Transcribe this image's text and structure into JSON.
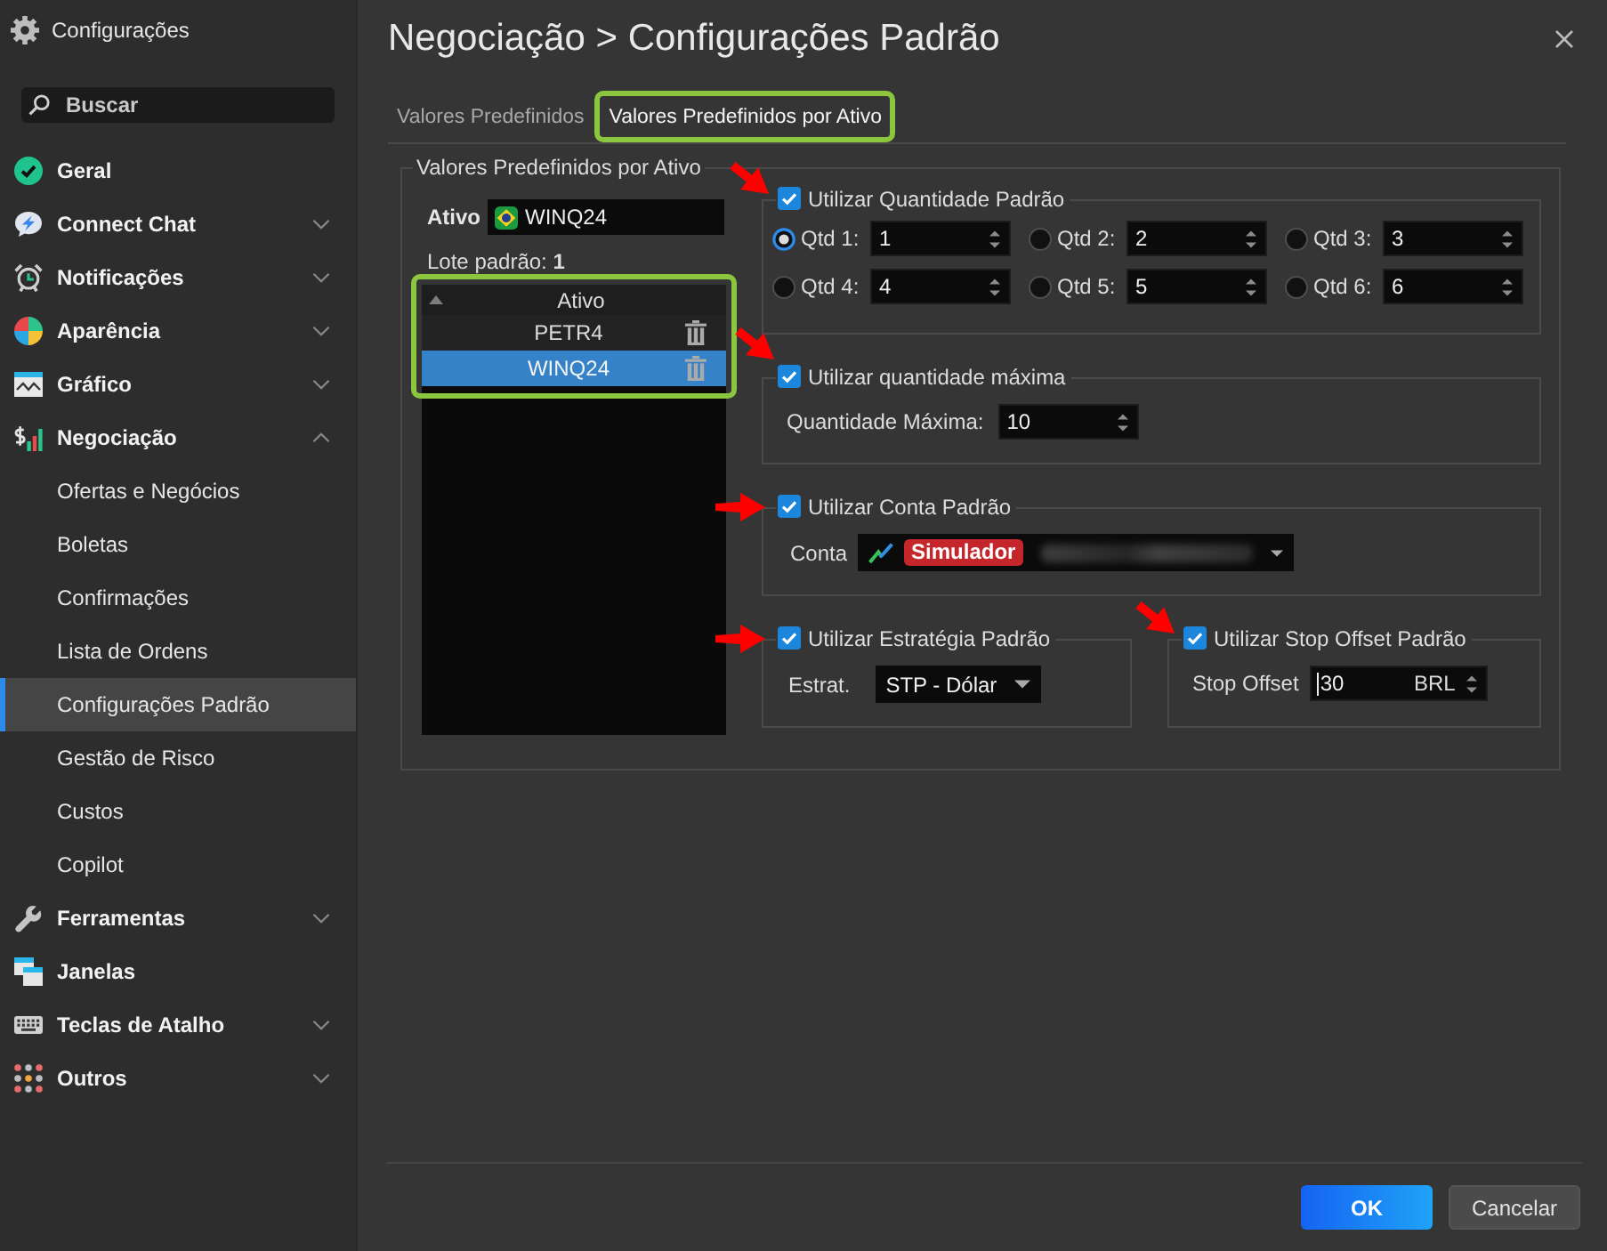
{
  "sidebar": {
    "title": "Configurações",
    "search": {
      "placeholder": "Buscar"
    },
    "items": [
      {
        "label": "Geral"
      },
      {
        "label": "Connect Chat",
        "expanded": false
      },
      {
        "label": "Notificações",
        "expanded": false
      },
      {
        "label": "Aparência",
        "expanded": false
      },
      {
        "label": "Gráfico",
        "expanded": false
      },
      {
        "label": "Negociação",
        "expanded": true,
        "children": [
          {
            "label": "Ofertas e Negócios",
            "selected": false
          },
          {
            "label": "Boletas",
            "selected": false
          },
          {
            "label": "Confirmações",
            "selected": false
          },
          {
            "label": "Lista de Ordens",
            "selected": false
          },
          {
            "label": "Configurações Padrão",
            "selected": true
          },
          {
            "label": "Gestão de Risco",
            "selected": false
          },
          {
            "label": "Custos",
            "selected": false
          },
          {
            "label": "Copilot",
            "selected": false
          }
        ]
      },
      {
        "label": "Ferramentas",
        "expanded": false
      },
      {
        "label": "Janelas"
      },
      {
        "label": "Teclas de Atalho",
        "expanded": false
      },
      {
        "label": "Outros",
        "expanded": false
      }
    ]
  },
  "header": {
    "title": "Negociação > Configurações Padrão"
  },
  "tabs": [
    {
      "label": "Valores Predefinidos",
      "selected": false,
      "highlighted": false
    },
    {
      "label": "Valores Predefinidos por Ativo",
      "selected": true,
      "highlighted": true
    }
  ],
  "asset_panel": {
    "legend": "Valores Predefinidos por Ativo",
    "asset_label": "Ativo",
    "asset_value": "WINQ24",
    "lot": "Lote padrão: **1**",
    "table": {
      "column": "Ativo",
      "highlighted": true,
      "rows": [
        {
          "symbol": "PETR4",
          "selected": false
        },
        {
          "symbol": "WINQ24",
          "selected": true
        }
      ]
    }
  },
  "settings": [
    {
      "kind": "quantities",
      "label": "Utilizar Quantidade Padrão",
      "checked": true,
      "annotation_arrow": true,
      "options": [
        {
          "label": "Qtd 1:",
          "value": "1",
          "selected": true
        },
        {
          "label": "Qtd 2:",
          "value": "2",
          "selected": false
        },
        {
          "label": "Qtd 3:",
          "value": "3",
          "selected": false
        },
        {
          "label": "Qtd 4:",
          "value": "4",
          "selected": false
        },
        {
          "label": "Qtd 5:",
          "value": "5",
          "selected": false
        },
        {
          "label": "Qtd 6:",
          "value": "6",
          "selected": false
        }
      ]
    },
    {
      "kind": "number",
      "label": "Utilizar quantidade máxima",
      "checked": true,
      "annotation_arrow": true,
      "field_label": "Quantidade Máxima:",
      "value": "10"
    },
    {
      "kind": "account",
      "label": "Utilizar Conta Padrão",
      "checked": true,
      "annotation_arrow": true,
      "field_label": "Conta",
      "badge": "Simulador",
      "account_masked": true
    },
    {
      "kind": "select",
      "label": "Utilizar Estratégia Padrão",
      "checked": true,
      "annotation_arrow": true,
      "field_label": "Estrat.",
      "value": "STP - Dólar"
    },
    {
      "kind": "offset",
      "label": "Utilizar Stop Offset Padrão",
      "checked": true,
      "annotation_arrow": true,
      "field_label": "Stop Offset",
      "value": "30",
      "unit": "BRL",
      "focused": true
    }
  ],
  "buttons": [
    {
      "label": "OK",
      "kind": "primary"
    },
    {
      "label": "Cancelar",
      "kind": "secondary"
    }
  ]
}
